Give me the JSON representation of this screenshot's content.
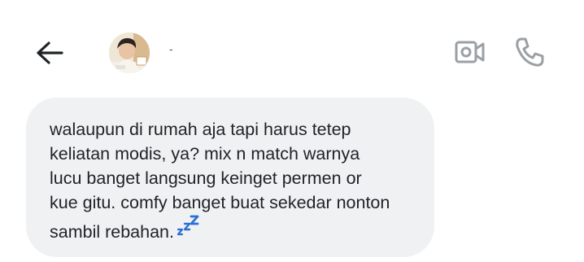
{
  "header": {
    "back_icon": "arrow-left-icon",
    "contact_name": "-",
    "video_icon": "video-camera-icon",
    "call_icon": "phone-icon"
  },
  "message": {
    "lines": [
      "walaupun di rumah aja tapi harus tetep",
      "keliatan modis, ya? mix n match warnya",
      "lucu banget langsung keinget permen or",
      "kue gitu. comfy banget buat sekedar nonton",
      "sambil rebahan."
    ],
    "emoji": "zzz-emoji"
  },
  "colors": {
    "icon": "#1f2326",
    "secondary_icon": "#9aa0a4",
    "bubble_bg": "#eff1f2",
    "text": "#1f2326",
    "emoji_blue": "#2b6fd6"
  }
}
